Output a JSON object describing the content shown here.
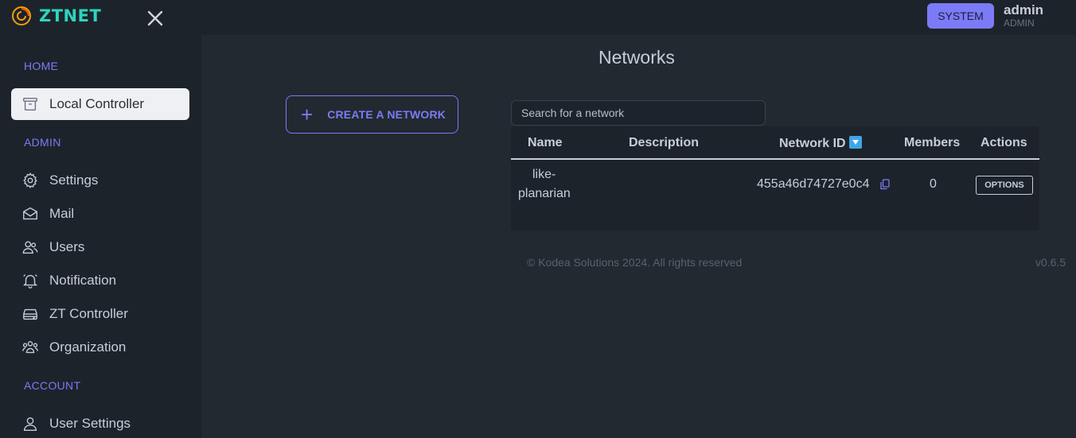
{
  "app": {
    "name": "ZTNET"
  },
  "header": {
    "system_label": "SYSTEM",
    "user_name": "admin",
    "user_role": "ADMIN"
  },
  "sidebar": {
    "sections": {
      "home": "HOME",
      "admin": "ADMIN",
      "account": "ACCOUNT"
    },
    "items": [
      {
        "label": "Local Controller",
        "icon": "archive-icon",
        "active": true
      },
      {
        "label": "Settings",
        "icon": "gear-icon"
      },
      {
        "label": "Mail",
        "icon": "mail-icon"
      },
      {
        "label": "Users",
        "icon": "users-icon"
      },
      {
        "label": "Notification",
        "icon": "bell-icon"
      },
      {
        "label": "ZT Controller",
        "icon": "server-icon"
      },
      {
        "label": "Organization",
        "icon": "organization-icon"
      },
      {
        "label": "User Settings",
        "icon": "user-icon"
      }
    ]
  },
  "main": {
    "title": "Networks",
    "create_label": "CREATE A NETWORK",
    "search_placeholder": "Search for a network",
    "table": {
      "headers": {
        "name": "Name",
        "description": "Description",
        "network_id": "Network ID",
        "members": "Members",
        "actions": "Actions"
      },
      "rows": [
        {
          "name_line1": "like-",
          "name_line2": "planarian",
          "description": "",
          "network_id": "455a46d74727e0c4",
          "members": "0",
          "action_label": "OPTIONS"
        }
      ]
    },
    "footer": {
      "copyright": "© Kodea Solutions 2024. All rights reserved",
      "version": "v0.6.5"
    }
  },
  "colors": {
    "accent": "#7b7bf7",
    "brand": "#2dd4bf",
    "background": "#1d232a"
  }
}
